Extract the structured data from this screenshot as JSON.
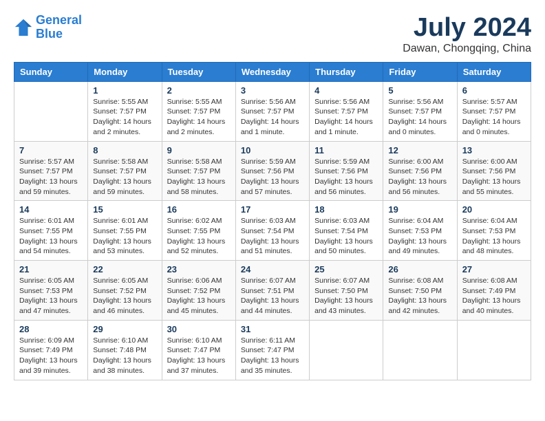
{
  "header": {
    "logo_line1": "General",
    "logo_line2": "Blue",
    "month_year": "July 2024",
    "location": "Dawan, Chongqing, China"
  },
  "columns": [
    "Sunday",
    "Monday",
    "Tuesday",
    "Wednesday",
    "Thursday",
    "Friday",
    "Saturday"
  ],
  "weeks": [
    [
      {
        "day": "",
        "info": ""
      },
      {
        "day": "1",
        "info": "Sunrise: 5:55 AM\nSunset: 7:57 PM\nDaylight: 14 hours\nand 2 minutes."
      },
      {
        "day": "2",
        "info": "Sunrise: 5:55 AM\nSunset: 7:57 PM\nDaylight: 14 hours\nand 2 minutes."
      },
      {
        "day": "3",
        "info": "Sunrise: 5:56 AM\nSunset: 7:57 PM\nDaylight: 14 hours\nand 1 minute."
      },
      {
        "day": "4",
        "info": "Sunrise: 5:56 AM\nSunset: 7:57 PM\nDaylight: 14 hours\nand 1 minute."
      },
      {
        "day": "5",
        "info": "Sunrise: 5:56 AM\nSunset: 7:57 PM\nDaylight: 14 hours\nand 0 minutes."
      },
      {
        "day": "6",
        "info": "Sunrise: 5:57 AM\nSunset: 7:57 PM\nDaylight: 14 hours\nand 0 minutes."
      }
    ],
    [
      {
        "day": "7",
        "info": "Sunrise: 5:57 AM\nSunset: 7:57 PM\nDaylight: 13 hours\nand 59 minutes."
      },
      {
        "day": "8",
        "info": "Sunrise: 5:58 AM\nSunset: 7:57 PM\nDaylight: 13 hours\nand 59 minutes."
      },
      {
        "day": "9",
        "info": "Sunrise: 5:58 AM\nSunset: 7:57 PM\nDaylight: 13 hours\nand 58 minutes."
      },
      {
        "day": "10",
        "info": "Sunrise: 5:59 AM\nSunset: 7:56 PM\nDaylight: 13 hours\nand 57 minutes."
      },
      {
        "day": "11",
        "info": "Sunrise: 5:59 AM\nSunset: 7:56 PM\nDaylight: 13 hours\nand 56 minutes."
      },
      {
        "day": "12",
        "info": "Sunrise: 6:00 AM\nSunset: 7:56 PM\nDaylight: 13 hours\nand 56 minutes."
      },
      {
        "day": "13",
        "info": "Sunrise: 6:00 AM\nSunset: 7:56 PM\nDaylight: 13 hours\nand 55 minutes."
      }
    ],
    [
      {
        "day": "14",
        "info": "Sunrise: 6:01 AM\nSunset: 7:55 PM\nDaylight: 13 hours\nand 54 minutes."
      },
      {
        "day": "15",
        "info": "Sunrise: 6:01 AM\nSunset: 7:55 PM\nDaylight: 13 hours\nand 53 minutes."
      },
      {
        "day": "16",
        "info": "Sunrise: 6:02 AM\nSunset: 7:55 PM\nDaylight: 13 hours\nand 52 minutes."
      },
      {
        "day": "17",
        "info": "Sunrise: 6:03 AM\nSunset: 7:54 PM\nDaylight: 13 hours\nand 51 minutes."
      },
      {
        "day": "18",
        "info": "Sunrise: 6:03 AM\nSunset: 7:54 PM\nDaylight: 13 hours\nand 50 minutes."
      },
      {
        "day": "19",
        "info": "Sunrise: 6:04 AM\nSunset: 7:53 PM\nDaylight: 13 hours\nand 49 minutes."
      },
      {
        "day": "20",
        "info": "Sunrise: 6:04 AM\nSunset: 7:53 PM\nDaylight: 13 hours\nand 48 minutes."
      }
    ],
    [
      {
        "day": "21",
        "info": "Sunrise: 6:05 AM\nSunset: 7:53 PM\nDaylight: 13 hours\nand 47 minutes."
      },
      {
        "day": "22",
        "info": "Sunrise: 6:05 AM\nSunset: 7:52 PM\nDaylight: 13 hours\nand 46 minutes."
      },
      {
        "day": "23",
        "info": "Sunrise: 6:06 AM\nSunset: 7:52 PM\nDaylight: 13 hours\nand 45 minutes."
      },
      {
        "day": "24",
        "info": "Sunrise: 6:07 AM\nSunset: 7:51 PM\nDaylight: 13 hours\nand 44 minutes."
      },
      {
        "day": "25",
        "info": "Sunrise: 6:07 AM\nSunset: 7:50 PM\nDaylight: 13 hours\nand 43 minutes."
      },
      {
        "day": "26",
        "info": "Sunrise: 6:08 AM\nSunset: 7:50 PM\nDaylight: 13 hours\nand 42 minutes."
      },
      {
        "day": "27",
        "info": "Sunrise: 6:08 AM\nSunset: 7:49 PM\nDaylight: 13 hours\nand 40 minutes."
      }
    ],
    [
      {
        "day": "28",
        "info": "Sunrise: 6:09 AM\nSunset: 7:49 PM\nDaylight: 13 hours\nand 39 minutes."
      },
      {
        "day": "29",
        "info": "Sunrise: 6:10 AM\nSunset: 7:48 PM\nDaylight: 13 hours\nand 38 minutes."
      },
      {
        "day": "30",
        "info": "Sunrise: 6:10 AM\nSunset: 7:47 PM\nDaylight: 13 hours\nand 37 minutes."
      },
      {
        "day": "31",
        "info": "Sunrise: 6:11 AM\nSunset: 7:47 PM\nDaylight: 13 hours\nand 35 minutes."
      },
      {
        "day": "",
        "info": ""
      },
      {
        "day": "",
        "info": ""
      },
      {
        "day": "",
        "info": ""
      }
    ]
  ]
}
